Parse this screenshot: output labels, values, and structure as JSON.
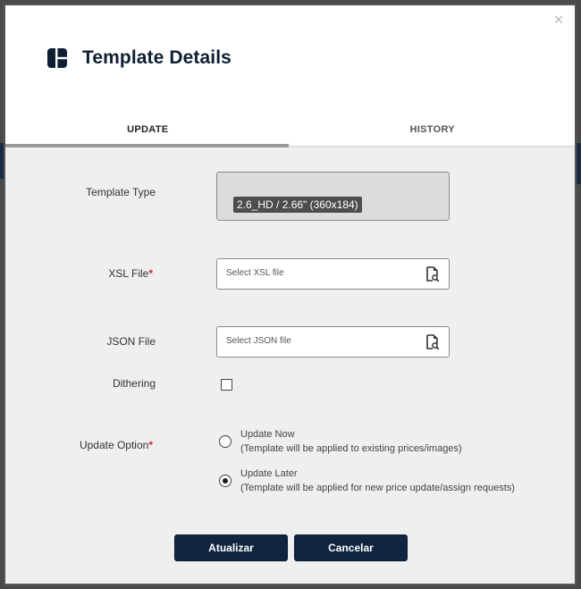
{
  "modal": {
    "title": "Template Details",
    "close_symbol": "×",
    "tabs": [
      {
        "label": "UPDATE",
        "active": true
      },
      {
        "label": "HISTORY",
        "active": false
      }
    ]
  },
  "form": {
    "template_type": {
      "label": "Template Type",
      "value": "2.6_HD / 2.66\" (360x184)"
    },
    "xsl_file": {
      "label": "XSL File",
      "required_mark": "*",
      "placeholder": "Select XSL file"
    },
    "json_file": {
      "label": "JSON File",
      "placeholder": "Select JSON file"
    },
    "dithering": {
      "label": "Dithering",
      "checked": false
    },
    "update_option": {
      "label": "Update Option",
      "required_mark": "*",
      "options": [
        {
          "title": "Update Now",
          "description": "(Template will be applied to existing prices/images)",
          "selected": false
        },
        {
          "title": "Update Later",
          "description": "(Template will be applied for new price update/assign requests)",
          "selected": true
        }
      ]
    }
  },
  "actions": {
    "submit_label": "Atualizar",
    "cancel_label": "Cancelar"
  },
  "colors": {
    "primary": "#0f2540",
    "required": "#d2262b",
    "chip": "#4d4d4d"
  }
}
